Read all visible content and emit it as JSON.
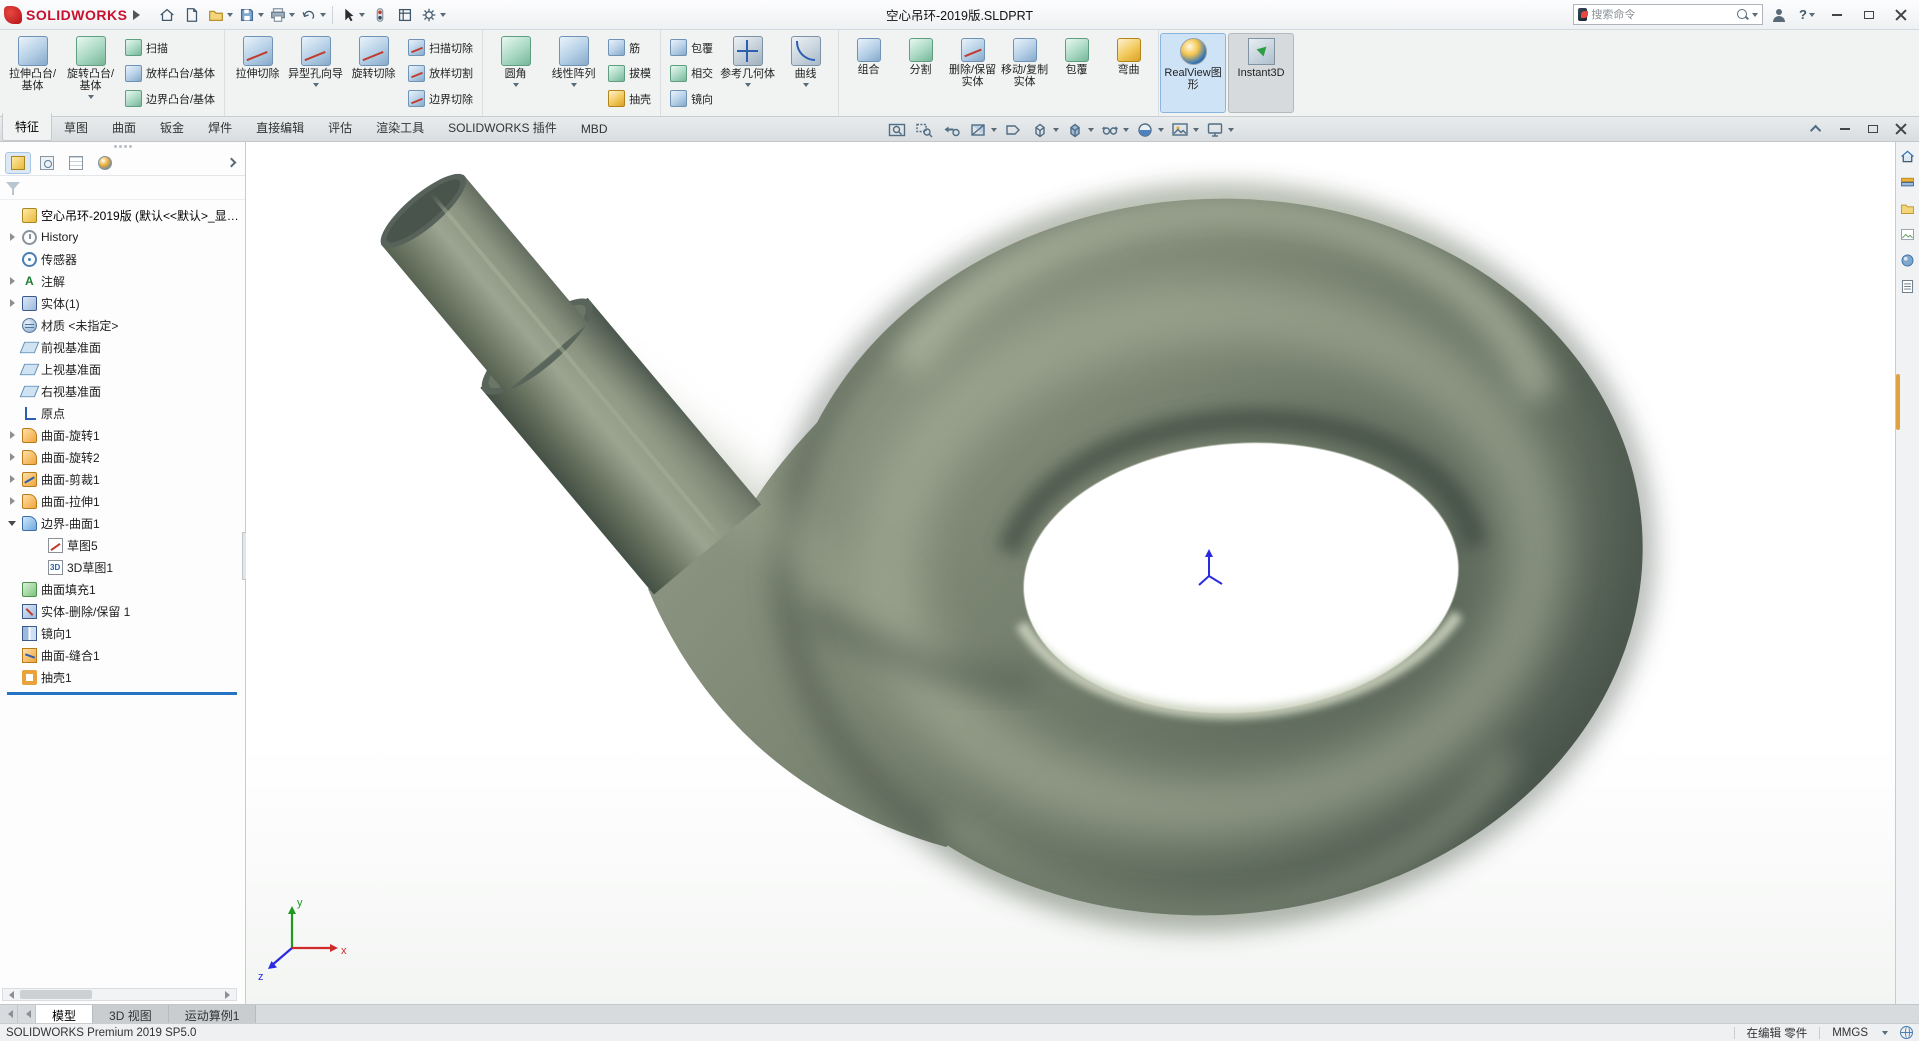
{
  "titlebar": {
    "brand": "SOLIDWORKS",
    "document_title": "空心吊环-2019版.SLDPRT",
    "search_placeholder": "搜索命令",
    "help_label": "?"
  },
  "command_tabs": [
    {
      "id": "features",
      "label": "特征",
      "active": true
    },
    {
      "id": "sketch",
      "label": "草图"
    },
    {
      "id": "surfaces",
      "label": "曲面"
    },
    {
      "id": "sheet-metal",
      "label": "钣金"
    },
    {
      "id": "weldments",
      "label": "焊件"
    },
    {
      "id": "direct-editing",
      "label": "直接编辑"
    },
    {
      "id": "evaluate",
      "label": "评估"
    },
    {
      "id": "render-tools",
      "label": "渲染工具"
    },
    {
      "id": "solidworks-add-ins",
      "label": "SOLIDWORKS 插件"
    },
    {
      "id": "mbd",
      "label": "MBD"
    }
  ],
  "ribbon": {
    "groups": [
      {
        "big": [
          {
            "id": "extruded-boss-base",
            "label": "拉伸凸台/基体",
            "chip": "c-blue"
          },
          {
            "id": "revolved-boss-base",
            "label": "旋转凸台/基体",
            "chip": "c-teal",
            "arrow": true
          }
        ],
        "small": [
          {
            "id": "swept-boss-base",
            "label": "扫描",
            "chip": "c-teal"
          },
          {
            "id": "lofted-boss-base",
            "label": "放样凸台/基体",
            "chip": "c-blue"
          },
          {
            "id": "boundary-boss-base",
            "label": "边界凸台/基体",
            "chip": "c-teal"
          }
        ]
      },
      {
        "big": [
          {
            "id": "extruded-cut",
            "label": "拉伸切除",
            "chip": "c-cut"
          },
          {
            "id": "hole-wizard",
            "label": "异型孔向导",
            "chip": "c-cut",
            "arrow": true
          },
          {
            "id": "revolved-cut",
            "label": "旋转切除",
            "chip": "c-cut"
          }
        ],
        "small": [
          {
            "id": "swept-cut",
            "label": "扫描切除",
            "chip": "c-cut"
          },
          {
            "id": "lofted-cut",
            "label": "放样切割",
            "chip": "c-cut"
          },
          {
            "id": "boundary-cut",
            "label": "边界切除",
            "chip": "c-cut"
          }
        ]
      },
      {
        "big": [
          {
            "id": "fillet",
            "label": "圆角",
            "chip": "c-teal",
            "arrow": true
          },
          {
            "id": "linear-pattern",
            "label": "线性阵列",
            "chip": "c-blue",
            "arrow": true
          }
        ],
        "small": [
          {
            "id": "rib",
            "label": "筋",
            "chip": "c-blue"
          },
          {
            "id": "draft",
            "label": "拔模",
            "chip": "c-teal"
          },
          {
            "id": "shell",
            "label": "抽壳",
            "chip": "c-orange"
          }
        ]
      },
      {
        "small_first": true,
        "small": [
          {
            "id": "wrap",
            "label": "包覆",
            "chip": "c-blue"
          },
          {
            "id": "intersect",
            "label": "相交",
            "chip": "c-teal"
          },
          {
            "id": "mirror",
            "label": "镜向",
            "chip": "c-blue"
          }
        ],
        "big": [
          {
            "id": "reference-geometry",
            "label": "参考几何体",
            "chip": "c-ref",
            "arrow": true
          },
          {
            "id": "curves",
            "label": "曲线",
            "chip": "c-curve",
            "arrow": true
          }
        ]
      },
      {
        "medium": [
          {
            "id": "combine",
            "label": "组合",
            "chip": "c-blue"
          },
          {
            "id": "split",
            "label": "分割",
            "chip": "c-teal"
          },
          {
            "id": "delete-keep-body",
            "label": "删除/保留实体",
            "chip": "c-cut"
          },
          {
            "id": "move-copy-body",
            "label": "移动/复制实体",
            "chip": "c-blue"
          },
          {
            "id": "wrap-2",
            "label": "包覆",
            "chip": "c-teal"
          },
          {
            "id": "flex",
            "label": "弯曲",
            "chip": "c-orange"
          }
        ]
      }
    ],
    "toggles": [
      {
        "id": "realview-graphics",
        "label": "RealView图形",
        "state": "active-blue"
      },
      {
        "id": "instant3d",
        "label": "Instant3D",
        "state": "active-gray"
      }
    ]
  },
  "feature_tree": {
    "root_label": "空心吊环-2019版 (默认<<默认>_显示状...",
    "items": [
      {
        "id": "history",
        "label": "History",
        "icon": "history",
        "arrow": "collapsed"
      },
      {
        "id": "sensors",
        "label": "传感器",
        "icon": "sensor"
      },
      {
        "id": "annotations",
        "label": "注解",
        "icon": "annotation",
        "arrow": "collapsed"
      },
      {
        "id": "solid-bodies",
        "label": "实体(1)",
        "icon": "bodies",
        "arrow": "collapsed"
      },
      {
        "id": "material",
        "label": "材质 <未指定>",
        "icon": "material"
      },
      {
        "id": "front-plane",
        "label": "前视基准面",
        "icon": "plane"
      },
      {
        "id": "top-plane",
        "label": "上视基准面",
        "icon": "plane"
      },
      {
        "id": "right-plane",
        "label": "右视基准面",
        "icon": "plane"
      },
      {
        "id": "origin",
        "label": "原点",
        "icon": "origin"
      },
      {
        "id": "surface-revolve-1",
        "label": "曲面-旋转1",
        "icon": "surface",
        "arrow": "collapsed"
      },
      {
        "id": "surface-revolve-2",
        "label": "曲面-旋转2",
        "icon": "surface",
        "arrow": "collapsed"
      },
      {
        "id": "surface-trim-1",
        "label": "曲面-剪裁1",
        "icon": "trim",
        "arrow": "collapsed"
      },
      {
        "id": "surface-extrude-1",
        "label": "曲面-拉伸1",
        "icon": "surface",
        "arrow": "collapsed"
      },
      {
        "id": "boundary-surface-1",
        "label": "边界-曲面1",
        "icon": "boundary",
        "arrow": "expanded"
      },
      {
        "id": "sketch-5",
        "label": "草图5",
        "icon": "sketch",
        "indent": 1
      },
      {
        "id": "3d-sketch-1",
        "label": "3D草图1",
        "icon": "sketch3d",
        "indent": 1
      },
      {
        "id": "surface-fill-1",
        "label": "曲面填充1",
        "icon": "fill"
      },
      {
        "id": "body-delete-keep-1",
        "label": "实体-删除/保留 1",
        "icon": "deletekeep"
      },
      {
        "id": "mirror-1",
        "label": "镜向1",
        "icon": "mirrorf"
      },
      {
        "id": "surface-knit-1",
        "label": "曲面-缝合1",
        "icon": "knit"
      },
      {
        "id": "shell-1",
        "label": "抽壳1",
        "icon": "shellf"
      }
    ]
  },
  "bottom_tabs": [
    {
      "id": "model",
      "label": "模型",
      "active": true
    },
    {
      "id": "3d-views",
      "label": "3D 视图"
    },
    {
      "id": "motion-study-1",
      "label": "运动算例1"
    }
  ],
  "statusbar": {
    "left": "SOLIDWORKS Premium 2019 SP5.0",
    "editing": "在编辑 零件",
    "units": "MMGS"
  },
  "viewport": {
    "triad_labels": {
      "x": "x",
      "y": "y",
      "z": "z"
    }
  },
  "colors": {
    "model_base": "#7d8774",
    "rollback_bar": "#2574c6",
    "realview_active_bg": "#cfe3f6",
    "taskpane_scroll_thumb": "#e0a23f",
    "brand_red": "#c8102e"
  }
}
